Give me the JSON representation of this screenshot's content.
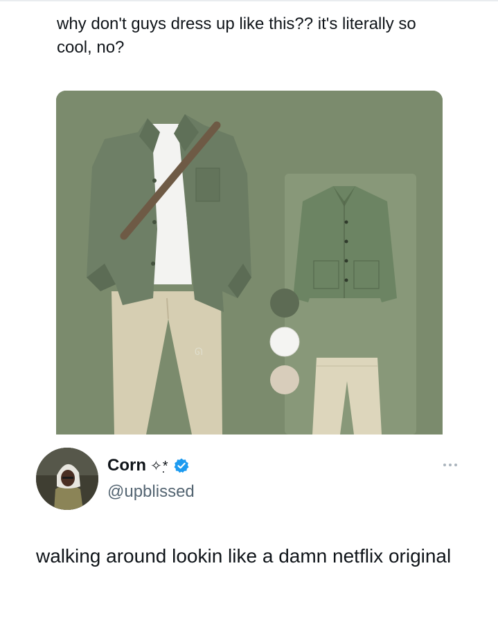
{
  "quoted_post": {
    "text": "why don't guys dress up like this?? it's literally so cool, no?"
  },
  "media": {
    "description_icon": "outfit-image",
    "background_color": "#7a8a6c",
    "swatches": [
      {
        "name": "dark-green",
        "color": "#5d6b54"
      },
      {
        "name": "white",
        "color": "#f4f4f2"
      },
      {
        "name": "beige",
        "color": "#d8cdbb"
      }
    ]
  },
  "author": {
    "display_name": "Corn",
    "name_decoration": "✧*̣",
    "handle": "@upblissed",
    "verified": true,
    "verified_color": "#1d9bf0"
  },
  "post": {
    "text": "walking around lookin like a damn netflix original"
  }
}
